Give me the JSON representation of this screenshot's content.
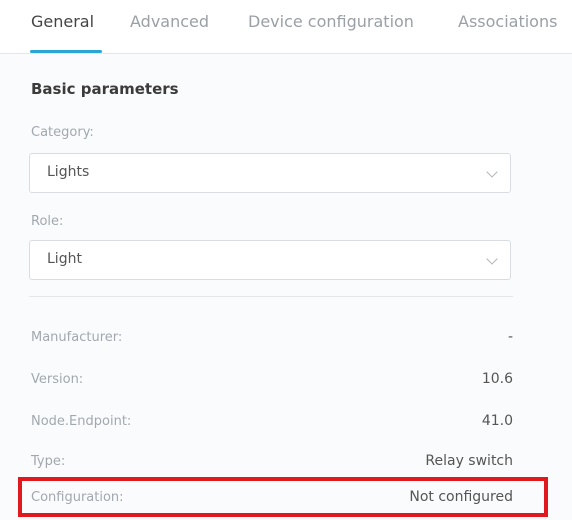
{
  "tabs": [
    {
      "label": "General",
      "active": true
    },
    {
      "label": "Advanced",
      "active": false
    },
    {
      "label": "Device configuration",
      "active": false
    },
    {
      "label": "Associations",
      "active": false
    }
  ],
  "section": {
    "title": "Basic parameters"
  },
  "category": {
    "label": "Category:",
    "value": "Lights"
  },
  "role": {
    "label": "Role:",
    "value": "Light"
  },
  "info": [
    {
      "label": "Manufacturer:",
      "value": "-"
    },
    {
      "label": "Version:",
      "value": "10.6"
    },
    {
      "label": "Node.Endpoint:",
      "value": "41.0"
    },
    {
      "label": "Type:",
      "value": "Relay switch"
    },
    {
      "label": "Configuration:",
      "value": "Not configured"
    }
  ],
  "colors": {
    "accent": "#2aa6d6",
    "highlight": "#e0191e"
  },
  "icons": {
    "select_chevron": "chevron-down-icon"
  }
}
